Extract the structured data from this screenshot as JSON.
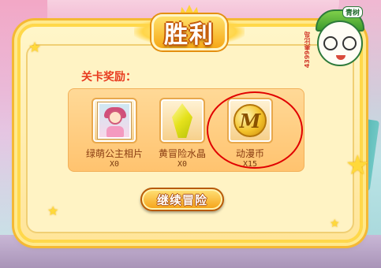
{
  "title": "胜利",
  "reward_label": "关卡奖励：",
  "rewards": [
    {
      "name": "绿萌公主相片",
      "count": "X0",
      "icon": "princess-photo-icon"
    },
    {
      "name": "黄冒险水晶",
      "count": "X0",
      "icon": "yellow-crystal-icon"
    },
    {
      "name": "动漫币",
      "count": "X15",
      "icon": "anime-coin-icon",
      "coin_letter": "M"
    }
  ],
  "continue_button": "继续冒险",
  "logo": {
    "text": "4399奥比岛",
    "tag": "青树"
  },
  "colors": {
    "accent": "#f5a014",
    "highlight": "#e00000",
    "label": "#e83c1e"
  }
}
